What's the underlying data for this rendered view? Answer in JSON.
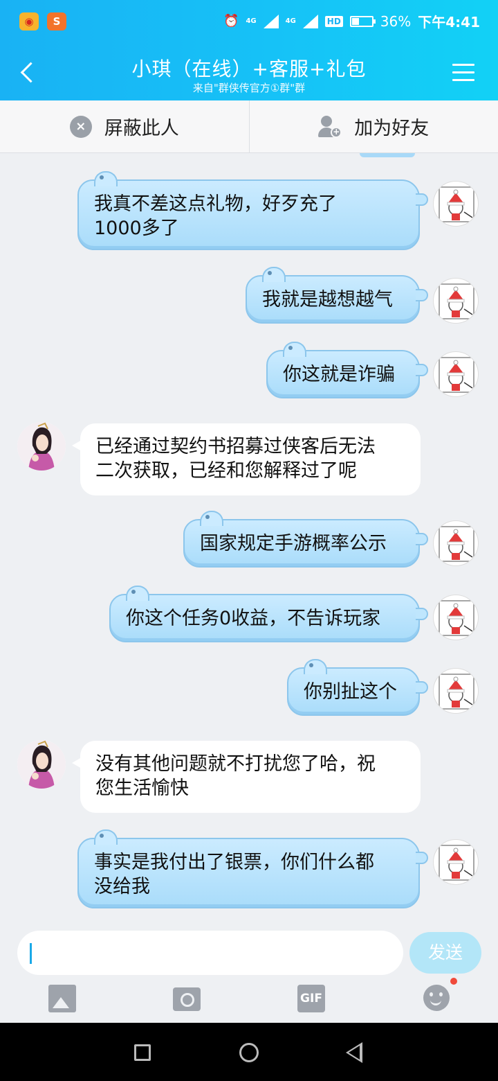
{
  "status_bar": {
    "network_1": "4G",
    "network_2": "4G",
    "hd": "HD",
    "battery": "36%",
    "time": "下午4:41"
  },
  "header": {
    "title": "小琪（在线）+客服+礼包",
    "subtitle": "来自\"群侠传官方①群\"群"
  },
  "actions": {
    "block_label": "屏蔽此人",
    "add_friend_label": "加为好友"
  },
  "messages": [
    {
      "side": "out",
      "text_lines": [
        "我真不差这点礼物，好歹充了",
        "1000多了"
      ]
    },
    {
      "side": "out",
      "text_lines": [
        "我就是越想越气"
      ]
    },
    {
      "side": "out",
      "text_lines": [
        "你这就是诈骗"
      ]
    },
    {
      "side": "in",
      "text_lines": [
        "已经通过契约书招募过侠客后无法",
        "二次获取，已经和您解释过了呢"
      ]
    },
    {
      "side": "out",
      "text_lines": [
        "国家规定手游概率公示"
      ]
    },
    {
      "side": "out",
      "text_lines": [
        "你这个任务0收益，不告诉玩家"
      ]
    },
    {
      "side": "out",
      "text_lines": [
        "你别扯这个"
      ]
    },
    {
      "side": "in",
      "text_lines": [
        "没有其他问题就不打扰您了哈，祝",
        "您生活愉快"
      ]
    },
    {
      "side": "out",
      "text_lines": [
        "事实是我付出了银票，你们什么都",
        "没给我"
      ]
    }
  ],
  "input": {
    "value": "",
    "send_label": "发送"
  },
  "toolbar": {
    "gif_label": "GIF"
  },
  "colors": {
    "header_gradient_start": "#19b2f4",
    "header_gradient_end": "#12d1f6",
    "bubble_out": "#b8e3fc",
    "send_button": "#b3e6f8"
  }
}
